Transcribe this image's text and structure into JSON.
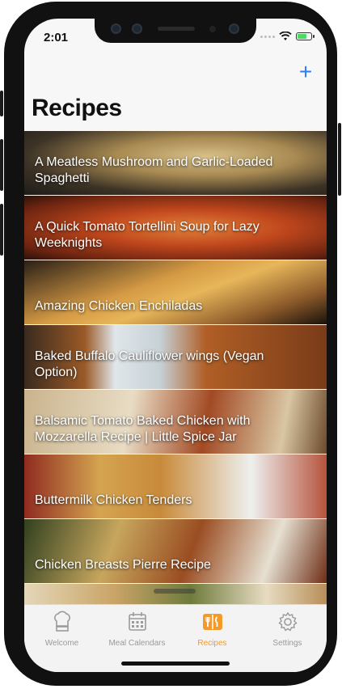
{
  "status_bar": {
    "time": "2:01"
  },
  "header": {
    "add_label": "+",
    "title": "Recipes"
  },
  "recipes": [
    {
      "title": "A Meatless Mushroom and Garlic-Loaded Spaghetti"
    },
    {
      "title": "A Quick Tomato Tortellini Soup for Lazy Weeknights"
    },
    {
      "title": "Amazing Chicken Enchiladas"
    },
    {
      "title": "Baked Buffalo Cauliflower wings (Vegan Option)"
    },
    {
      "title": "Balsamic Tomato Baked Chicken with Mozzarella Recipe | Little Spice Jar"
    },
    {
      "title": "Buttermilk Chicken Tenders"
    },
    {
      "title": "Chicken Breasts Pierre Recipe"
    },
    {
      "title": ""
    }
  ],
  "tabs": [
    {
      "label": "Welcome",
      "icon": "chef-hat-icon",
      "active": false
    },
    {
      "label": "Meal Calendars",
      "icon": "calendar-icon",
      "active": false
    },
    {
      "label": "Recipes",
      "icon": "recipe-book-icon",
      "active": true
    },
    {
      "label": "Settings",
      "icon": "gear-icon",
      "active": false
    }
  ],
  "colors": {
    "accent": "#f39a2a",
    "add_button": "#2f7df6",
    "tab_inactive": "#9a9a9a"
  }
}
